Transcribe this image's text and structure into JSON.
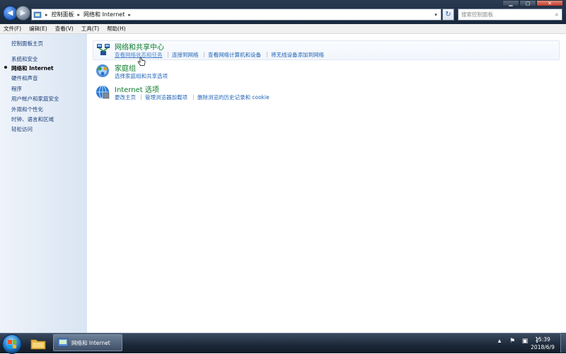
{
  "address_bar": {
    "breadcrumbs": [
      "控制面板",
      "网络和 Internet"
    ]
  },
  "search": {
    "placeholder": "搜索控制面板"
  },
  "menu": [
    "文件(F)",
    "编辑(E)",
    "查看(V)",
    "工具(T)",
    "帮助(H)"
  ],
  "sidebar": {
    "home": "控制面板主页",
    "items": [
      "系统和安全",
      "网络和 Internet",
      "硬件和声音",
      "程序",
      "用户帐户和家庭安全",
      "外观和个性化",
      "时钟、语言和区域",
      "轻松访问"
    ],
    "active_index": 1
  },
  "categories": [
    {
      "title": "网络和共享中心",
      "tasks": [
        "查看网络状态和任务",
        "连接到网络",
        "查看网络计算机和设备",
        "将无线设备添加到网络"
      ]
    },
    {
      "title": "家庭组",
      "tasks": [
        "选择家庭组和共享选项"
      ]
    },
    {
      "title": "Internet 选项",
      "tasks": [
        "更改主页",
        "管理浏览器加载项",
        "删除浏览的历史记录和 cookie"
      ]
    }
  ],
  "taskbar": {
    "active_window": "网络和 Internet",
    "time": "15:39",
    "date": "2018/6/9"
  },
  "colors": {
    "category_title": "#0b7b2b",
    "link": "#1f63b5",
    "sidebar_link": "#1a3d7a",
    "title_bar": "#18263a"
  }
}
